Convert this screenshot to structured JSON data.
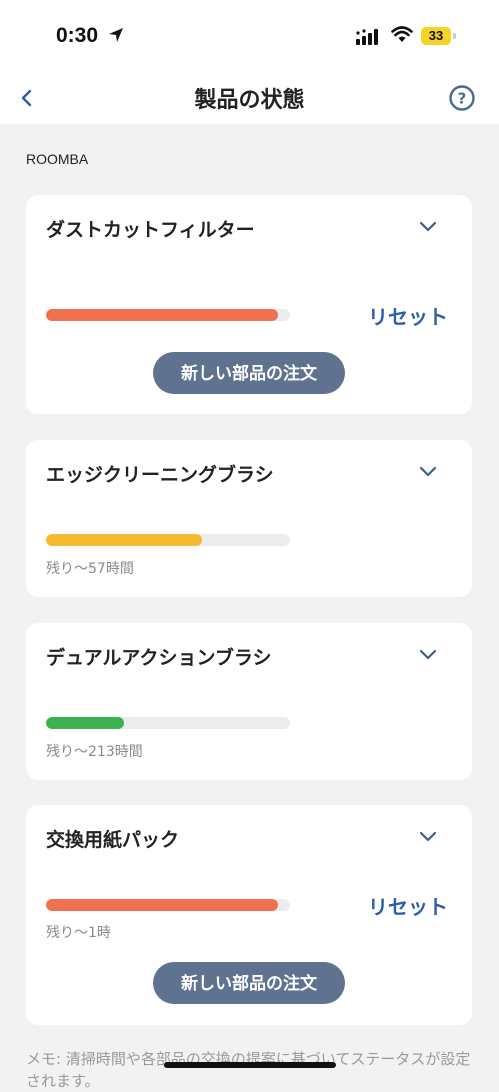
{
  "status_bar": {
    "time": "0:30",
    "battery": "33"
  },
  "nav": {
    "title": "製品の状態"
  },
  "section": {
    "label": "ROOMBA"
  },
  "cards": [
    {
      "title": "ダストカットフィルター",
      "level": 0.95,
      "bar_color": "#f07150",
      "remaining": "",
      "reset": "リセット",
      "order": "新しい部品の注文"
    },
    {
      "title": "エッジクリーニングブラシ",
      "level": 0.64,
      "bar_color": "#f7b92f",
      "remaining": "残り～57時間"
    },
    {
      "title": "デュアルアクションブラシ",
      "level": 0.32,
      "bar_color": "#3bb24f",
      "remaining": "残り～213時間"
    },
    {
      "title": "交換用紙パック",
      "level": 0.95,
      "bar_color": "#f07150",
      "remaining": "残り～1時",
      "reset": "リセット",
      "order": "新しい部品の注文"
    }
  ],
  "memo": "メモ: 清掃時間や各部品の交換の提案に基づいてステータスが設定されます。",
  "icons": {
    "back": "chevron-left-icon",
    "help": "question-circle-icon",
    "expand": "chevron-down-icon",
    "location": "location-arrow-icon",
    "signal": "cellular-signal-icon",
    "wifi": "wifi-icon",
    "battery": "battery-icon"
  },
  "colors": {
    "accent": "#2d5fa6",
    "button": "#5f7390"
  }
}
